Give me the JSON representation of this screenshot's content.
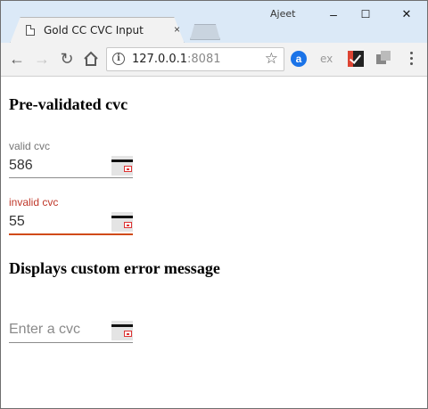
{
  "browser": {
    "tab_title": "Gold CC CVC Input",
    "tab_close": "×",
    "user_name": "Ajeet",
    "window_controls": {
      "minimize": "–",
      "maximize": "☐",
      "close": "✕"
    },
    "url_host": "127.0.0.1",
    "url_port": ":8081",
    "extensions": {
      "a": "a",
      "ex": "ex"
    }
  },
  "page": {
    "section1_title": "Pre-validated cvc",
    "section2_title": "Displays custom error message",
    "fields": [
      {
        "label": "valid cvc",
        "value": "586",
        "state": "valid"
      },
      {
        "label": "invalid cvc",
        "value": "55",
        "state": "invalid"
      },
      {
        "placeholder": "Enter a cvc",
        "value": ""
      }
    ]
  },
  "colors": {
    "error_label": "#c0392b",
    "error_underline": "#d04a18",
    "titlebar": "#dbe9f7"
  }
}
